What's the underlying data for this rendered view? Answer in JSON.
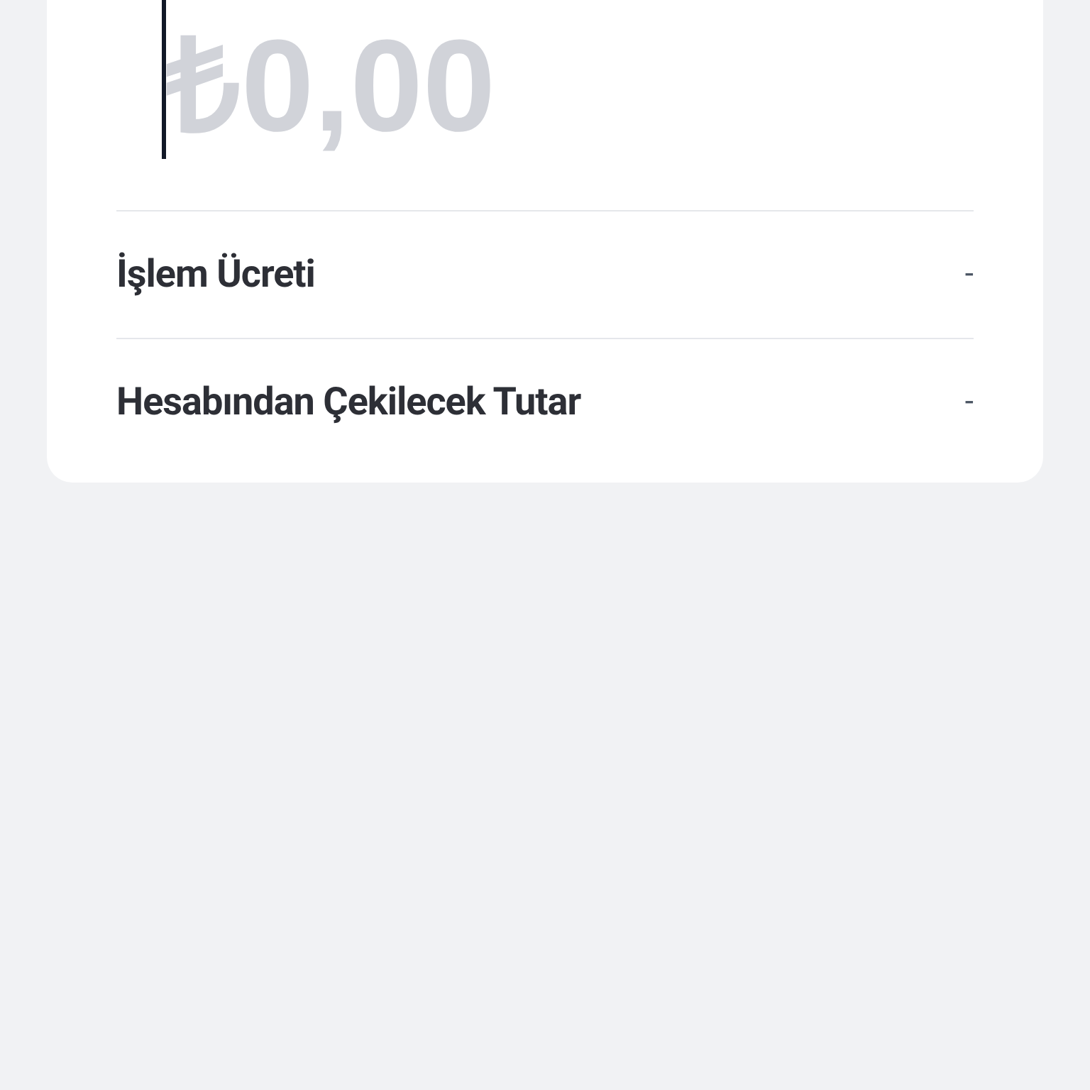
{
  "amount_field": {
    "placeholder": "₺0,00"
  },
  "rows": [
    {
      "label": "İşlem Ücreti",
      "value": "-"
    },
    {
      "label": "Hesabından Çekilecek Tutar",
      "value": "-"
    }
  ]
}
